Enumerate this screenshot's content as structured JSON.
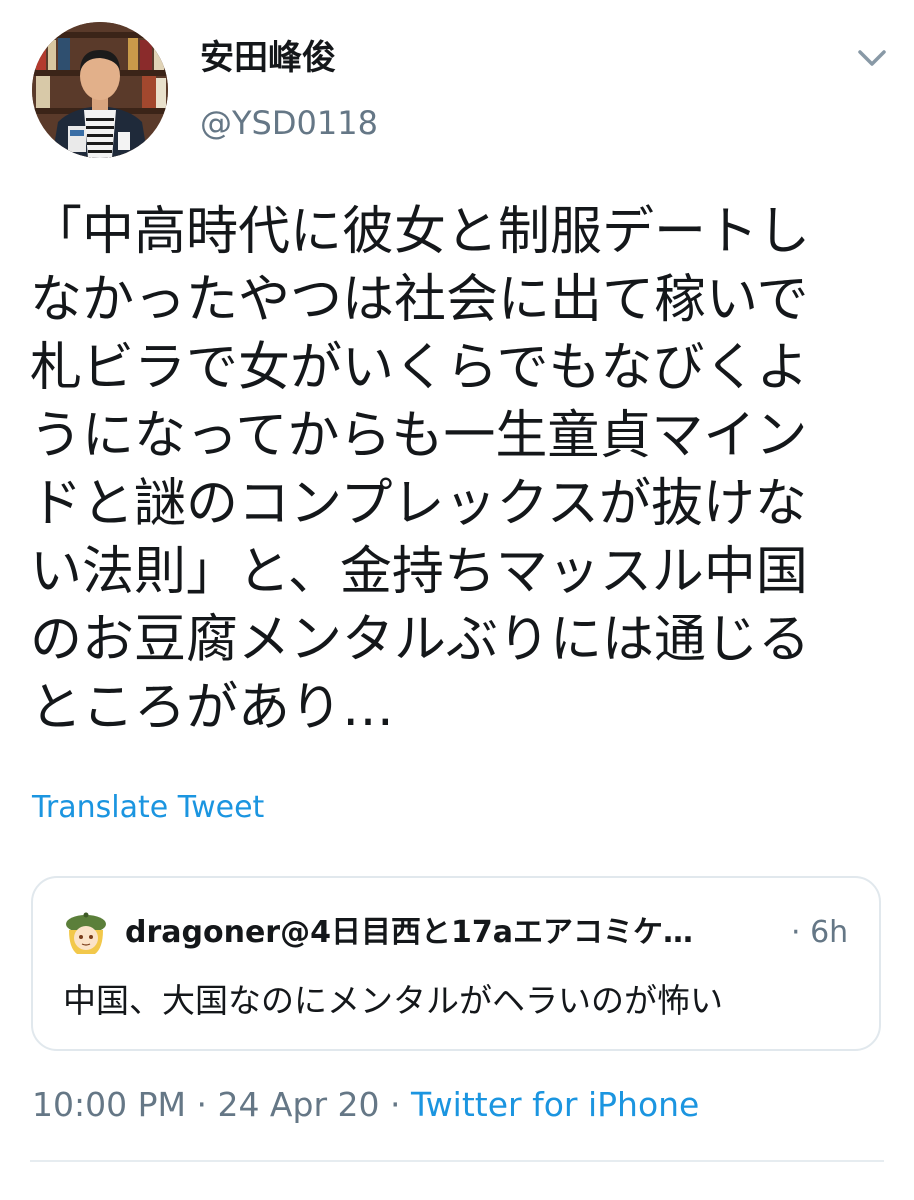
{
  "tweet": {
    "author": {
      "display_name": "安田峰俊",
      "handle": "@YSD0118"
    },
    "body_lines": [
      "「中高時代に彼女と制服デートし",
      "なかったやつは社会に出て稼いで",
      "札ビラで女がいくらでもなびくよ",
      "うになってからも一生童貞マイン",
      "ドと謎のコンプレックスが抜けな",
      "い法則」と、金持ちマッスル中国",
      "のお豆腐メンタルぶりには通じる",
      "ところがあり…"
    ],
    "translate_label": "Translate Tweet",
    "quote": {
      "author_name": "dragoner@4日目西と17aエアコミケ…",
      "time": "· 6h",
      "text": "中国、大国なのにメンタルがヘラいのが怖い"
    },
    "meta": {
      "time": "10:00 PM",
      "separator": " · ",
      "date": "24 Apr 20",
      "source": "Twitter for iPhone"
    }
  },
  "icons": {
    "caret": "chevron-down-icon",
    "avatar": "user-avatar",
    "quote_avatar": "quoted-user-avatar"
  },
  "colors": {
    "text": "#14171a",
    "secondary": "#657786",
    "link": "#1b95e0",
    "border": "#e1e8ed"
  }
}
